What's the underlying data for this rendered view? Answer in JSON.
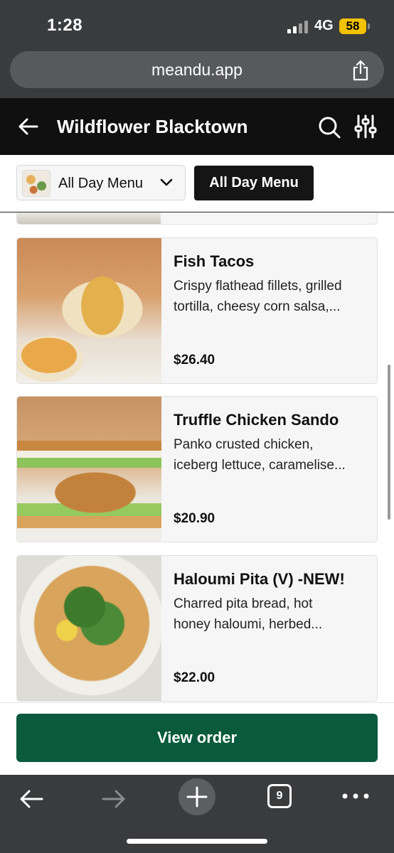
{
  "status_bar": {
    "time": "1:28",
    "network": "4G",
    "battery": "58"
  },
  "browser": {
    "url": "meandu.app",
    "tab_count": "9"
  },
  "header": {
    "title": "Wildflower Blacktown"
  },
  "menu_selector": {
    "dropdown_label": "All Day Menu",
    "active_tab": "All Day Menu"
  },
  "items": [
    {
      "name": "Fish Tacos",
      "desc_line1": "Crispy flathead fillets, grilled",
      "desc_line2": "tortilla, cheesy corn salsa,...",
      "price": "$26.40"
    },
    {
      "name": "Truffle Chicken Sando",
      "desc_line1": "Panko crusted chicken,",
      "desc_line2": "iceberg lettuce, caramelise...",
      "price": "$20.90"
    },
    {
      "name": "Haloumi Pita (V) -NEW!",
      "desc_line1": "Charred pita bread, hot",
      "desc_line2": "honey haloumi, herbed...",
      "price": "$22.00"
    }
  ],
  "order": {
    "button_label": "View order"
  },
  "colors": {
    "header_bg": "#101010",
    "order_button": "#0a5a3d",
    "browser_chrome": "#3a3b3d",
    "battery": "#f2c200"
  },
  "icons": [
    "back-arrow-icon",
    "search-icon",
    "filter-sliders-icon",
    "chevron-down-icon",
    "share-icon",
    "plus-icon",
    "more-dots-icon"
  ]
}
